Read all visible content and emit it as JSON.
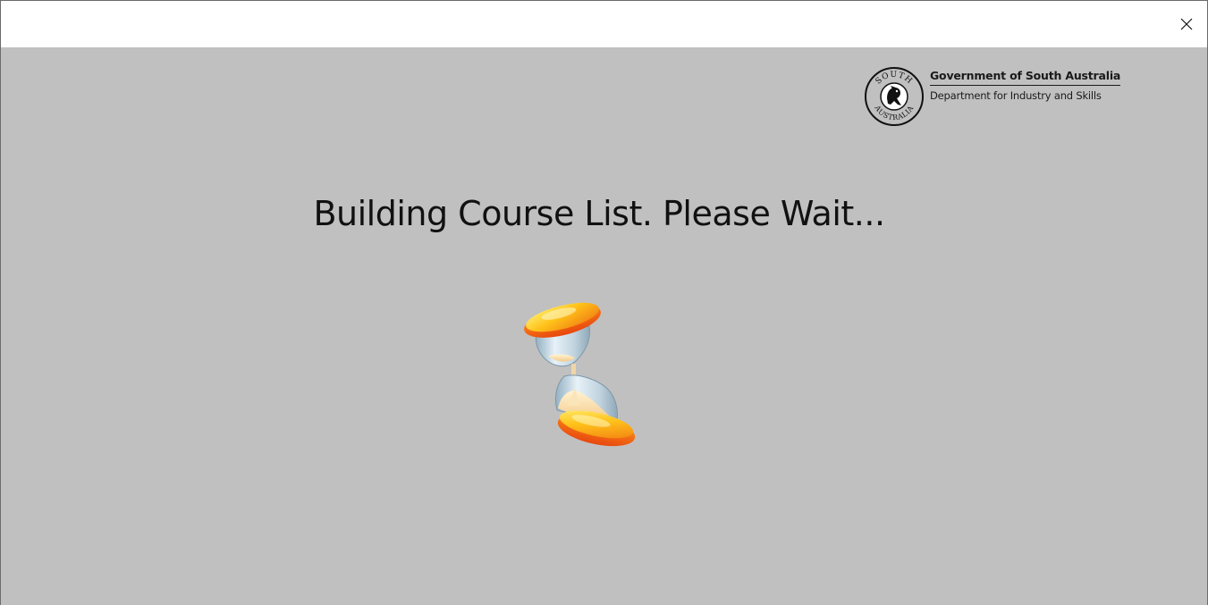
{
  "window": {
    "close_label": "Close"
  },
  "branding": {
    "government": "Government of South Australia",
    "department": "Department for Industry and Skills",
    "seal_top_text": "SOUTH",
    "seal_bottom_text": "AUSTRALIA"
  },
  "status": {
    "message": "Building Course List. Please Wait..."
  },
  "icons": {
    "close": "close-icon",
    "hourglass": "hourglass-icon",
    "seal": "south-australia-seal-icon"
  },
  "colors": {
    "background": "#c0c0c0",
    "titlebar": "#ffffff",
    "hourglass_gold": "#f7a01a",
    "hourglass_orange": "#f05a12"
  }
}
